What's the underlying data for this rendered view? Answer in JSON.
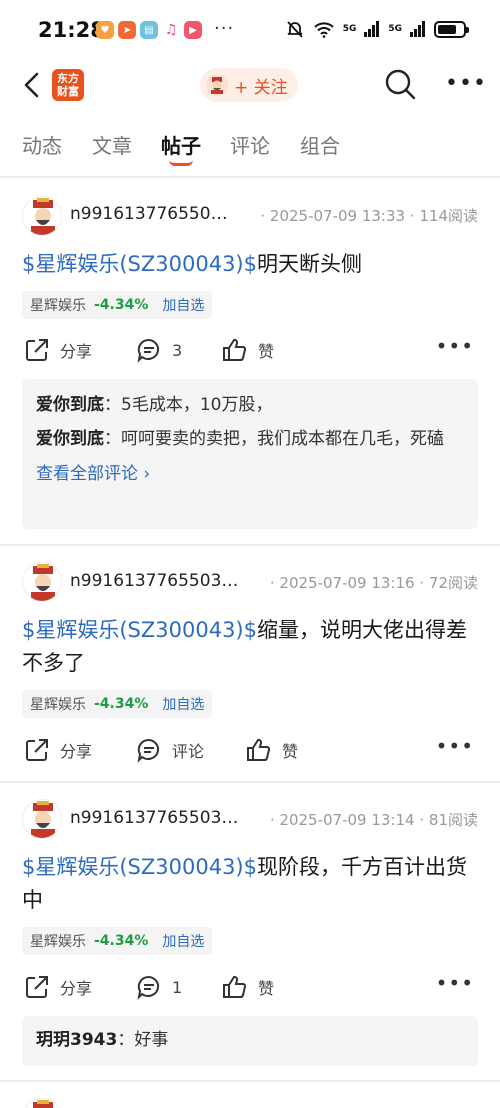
{
  "status_bar": {
    "time": "21:28",
    "dots": "···",
    "signal1": "5G",
    "signal2": "5G",
    "app_icons": [
      {
        "name": "app-icon-heart",
        "color": "#f4a340"
      },
      {
        "name": "app-icon-send",
        "color": "#f06a35"
      },
      {
        "name": "app-icon-book",
        "color": "#6fc3df"
      },
      {
        "name": "app-icon-music",
        "color": "#ef4f6c"
      },
      {
        "name": "app-icon-play",
        "color": "#f2566a"
      }
    ]
  },
  "header": {
    "logo_line1": "东方",
    "logo_line2": "财富",
    "follow_label": "+ 关注"
  },
  "tabs": [
    {
      "label": "动态",
      "active": false
    },
    {
      "label": "文章",
      "active": false
    },
    {
      "label": "帖子",
      "active": true
    },
    {
      "label": "评论",
      "active": false
    },
    {
      "label": "组合",
      "active": false
    }
  ],
  "colors": {
    "accent": "#e8521e",
    "stock_link": "#2c6bc1",
    "down_green": "#1e9d45"
  },
  "posts": [
    {
      "username": "n991613776550…",
      "meta": "· 2025-07-09 13:33 · 114阅读",
      "title_stock": "$星辉娱乐(SZ300043)$",
      "title_text": "明天断头侧",
      "tag_name": "星辉娱乐",
      "tag_change": "-4.34%",
      "tag_add": "加自选",
      "share_label": "分享",
      "comment_label": "3",
      "like_label": "赞",
      "comments": [
        {
          "author": "爱你到底",
          "text": "5毛成本，10万股，"
        },
        {
          "author": "爱你到底",
          "text": "呵呵要卖的卖把，我们成本都在几毛，死磕"
        }
      ],
      "view_all": "查看全部评论 ›"
    },
    {
      "username": "n9916137765503…",
      "meta": "· 2025-07-09 13:16 · 72阅读",
      "title_stock": "$星辉娱乐(SZ300043)$",
      "title_text": "缩量，说明大佬出得差不多了",
      "tag_name": "星辉娱乐",
      "tag_change": "-4.34%",
      "tag_add": "加自选",
      "share_label": "分享",
      "comment_label": "评论",
      "like_label": "赞"
    },
    {
      "username": "n9916137765503…",
      "meta": "· 2025-07-09 13:14 · 81阅读",
      "title_stock": "$星辉娱乐(SZ300043)$",
      "title_text": "现阶段，千方百计出货中",
      "tag_name": "星辉娱乐",
      "tag_change": "-4.34%",
      "tag_add": "加自选",
      "share_label": "分享",
      "comment_label": "1",
      "like_label": "赞",
      "comments": [
        {
          "author": "玥玥3943",
          "text": "好事"
        }
      ]
    }
  ]
}
